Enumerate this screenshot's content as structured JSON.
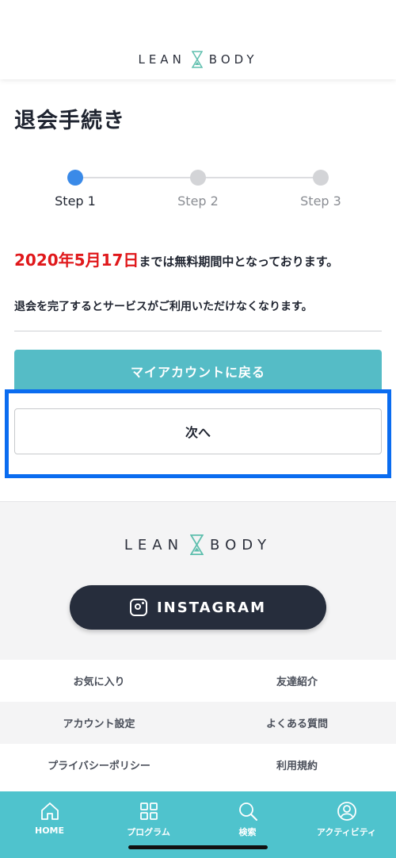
{
  "brand": {
    "left": "LEAN",
    "right": "BODY"
  },
  "page_title": "退会手続き",
  "steps": [
    {
      "label": "Step 1",
      "active": true
    },
    {
      "label": "Step 2",
      "active": false
    },
    {
      "label": "Step 3",
      "active": false
    }
  ],
  "notice": {
    "date": "2020年5月17日",
    "text": "までは無料期間中となっております。"
  },
  "info": "退会を完了するとサービスがご利用いただけなくなります。",
  "buttons": {
    "back": "マイアカウントに戻る",
    "next": "次へ"
  },
  "footer": {
    "instagram": "INSTAGRAM",
    "links": [
      [
        "お気に入り",
        "友達紹介"
      ],
      [
        "アカウント設定",
        "よくある質問"
      ],
      [
        "プライバシーポリシー",
        "利用規約"
      ]
    ]
  },
  "nav": [
    {
      "label": "HOME",
      "icon": "home-icon"
    },
    {
      "label": "プログラム",
      "icon": "grid-icon"
    },
    {
      "label": "検索",
      "icon": "search-icon"
    },
    {
      "label": "アクティビティ",
      "icon": "person-icon"
    }
  ],
  "colors": {
    "accent": "#55bcc6",
    "nav": "#4fc3cd",
    "step_active": "#3a8ae8",
    "date_red": "#e0181b",
    "highlight": "#0a6cf0"
  }
}
